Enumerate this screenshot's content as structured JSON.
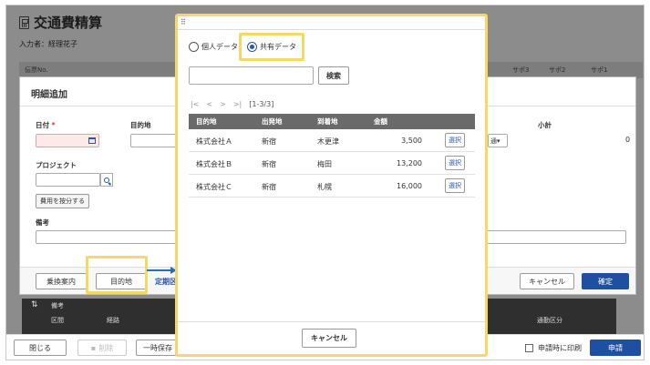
{
  "app": {
    "title": "交通費精算",
    "inputter": "入力者：経理花子"
  },
  "voucher_header": {
    "cells": [
      "伝票No.",
      "サポ3",
      "サポ2",
      "サポ1"
    ]
  },
  "detail_dialog": {
    "title": "明細追加",
    "date_label": "日付",
    "required_mark": "*",
    "destination_label": "目的地",
    "subtotal_label": "小計",
    "subtotal_value": "0",
    "project_label": "プロジェクト",
    "split_button": "費用を按分する",
    "remarks_label": "備考",
    "transfer_button": "乗換案内",
    "destination_button": "目的地",
    "regular_link": "定期区",
    "cancel_button": "キャンセル",
    "confirm_button": "確定",
    "select_value": "通"
  },
  "route_table": {
    "remarks": "備考",
    "section": "区間",
    "route": "経路",
    "commute": "通勤区分"
  },
  "bottom_bar": {
    "close_button": "閉じる",
    "delete_button": "削除",
    "save_button": "一時保存",
    "print_checkbox": "申請時に印刷",
    "apply_button": "申請"
  },
  "picker": {
    "radio_personal": "個人データ",
    "radio_shared": "共有データ",
    "search_value": "",
    "search_button": "検索",
    "pager": {
      "first": "|<",
      "prev": "<",
      "next": ">",
      "last": ">|",
      "count": "[1-3/3]"
    },
    "columns": [
      "目的地",
      "出発地",
      "到着地",
      "金額"
    ],
    "rows": [
      {
        "destination": "株式会社Ａ",
        "from": "新宿",
        "to": "木更津",
        "amount": "3,500",
        "select": "選択"
      },
      {
        "destination": "株式会社Ｂ",
        "from": "新宿",
        "to": "梅田",
        "amount": "13,200",
        "select": "選択"
      },
      {
        "destination": "株式会社Ｃ",
        "from": "新宿",
        "to": "札幌",
        "amount": "16,000",
        "select": "選択"
      }
    ],
    "cancel_button": "キャンセル"
  },
  "colors": {
    "accent": "#1f4fa3",
    "highlight": "#f5d86a",
    "grid_header": "#6a6a6a"
  }
}
